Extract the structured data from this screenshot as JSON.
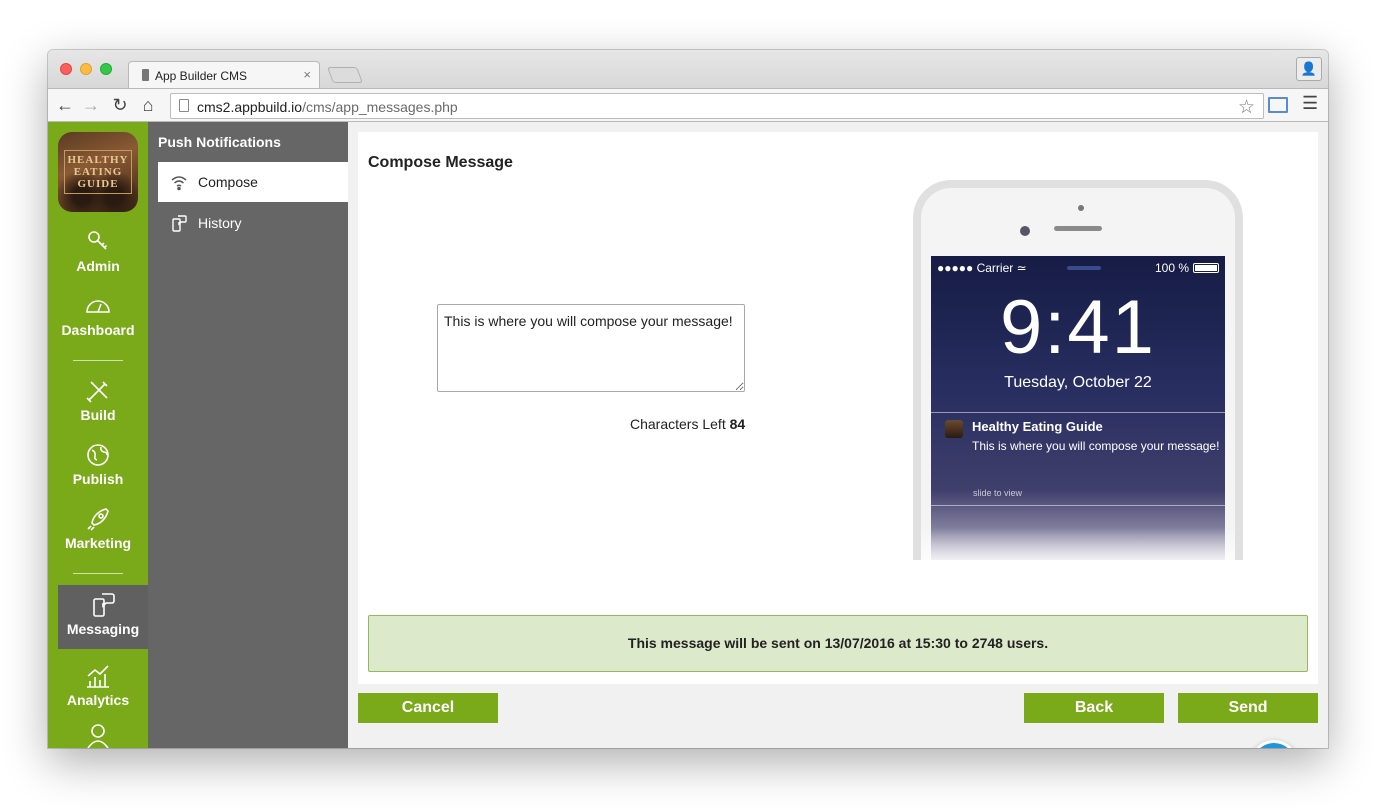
{
  "browser": {
    "tab_title": "App Builder CMS",
    "tab_close": "×",
    "url_host": "cms2.appbuild.io",
    "url_path": "/cms/app_messages.php"
  },
  "app": {
    "logo_text": "HEALTHY EATING GUIDE"
  },
  "sidebar": {
    "items": [
      {
        "label": "Admin",
        "icon": "key-icon"
      },
      {
        "label": "Dashboard",
        "icon": "dashboard-icon"
      },
      {
        "label": "Build",
        "icon": "tools-icon"
      },
      {
        "label": "Publish",
        "icon": "globe-icon"
      },
      {
        "label": "Marketing",
        "icon": "rocket-icon"
      },
      {
        "label": "Messaging",
        "icon": "phone-message-icon",
        "active": true
      },
      {
        "label": "Analytics",
        "icon": "chart-icon"
      },
      {
        "label": "",
        "icon": "user-icon"
      }
    ]
  },
  "subnav": {
    "title": "Push Notifications",
    "items": [
      {
        "label": "Compose",
        "icon": "wifi-icon",
        "active": true
      },
      {
        "label": "History",
        "icon": "history-icon"
      }
    ]
  },
  "compose": {
    "title": "Compose Message",
    "message_value": "This is where you will compose your message!",
    "chars_left_label": "Characters Left",
    "chars_left_value": "84"
  },
  "preview": {
    "carrier": "●●●●● Carrier",
    "battery": "100 %",
    "time": "9:41",
    "date": "Tuesday, October 22",
    "notif_app": "Healthy Eating Guide",
    "notif_body": "This is where you will compose your message!",
    "slide_text": "slide to view"
  },
  "schedule": {
    "text": "This message will be sent on 13/07/2016 at 15:30 to 2748 users."
  },
  "buttons": {
    "cancel": "Cancel",
    "back": "Back",
    "send": "Send",
    "help": "?"
  },
  "colors": {
    "accent_green": "#7aa919",
    "subnav_grey": "#666666",
    "help_blue": "#1c98db",
    "notice_bg": "#dde9cb"
  }
}
